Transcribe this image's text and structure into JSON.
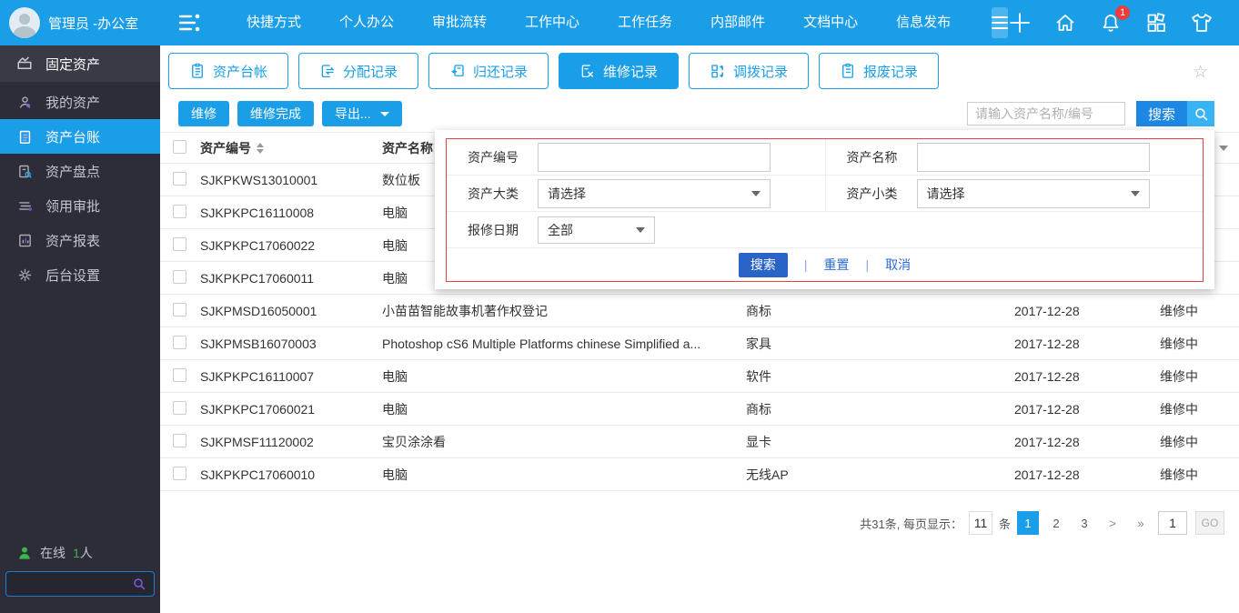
{
  "colors": {
    "accent": "#1b9ee8",
    "sidebar_bg": "#2d2d39",
    "panel_border_red": "#dd4444",
    "panel_button_blue": "#2a64c6",
    "badge_red": "#ee3b3b",
    "online_green": "#3bb54a"
  },
  "topbar": {
    "user": "管理员 -办公室",
    "menu": [
      "快捷方式",
      "个人办公",
      "审批流转",
      "工作中心",
      "工作任务",
      "内部邮件",
      "文档中心",
      "信息发布"
    ],
    "notification_badge": "1"
  },
  "sidebar": {
    "module": "固定资产",
    "items": [
      {
        "label": "我的资产",
        "active": false
      },
      {
        "label": "资产台账",
        "active": true
      },
      {
        "label": "资产盘点",
        "active": false
      },
      {
        "label": "领用审批",
        "active": false
      },
      {
        "label": "资产报表",
        "active": false
      },
      {
        "label": "后台设置",
        "active": false
      }
    ],
    "online_label": "在线",
    "online_count": "1",
    "online_unit": "人"
  },
  "tabs": [
    {
      "label": "资产台帐",
      "active": false
    },
    {
      "label": "分配记录",
      "active": false
    },
    {
      "label": "归还记录",
      "active": false
    },
    {
      "label": "维修记录",
      "active": true
    },
    {
      "label": "调拨记录",
      "active": false
    },
    {
      "label": "报废记录",
      "active": false
    }
  ],
  "toolbar": {
    "repair_label": "维修",
    "repair_done_label": "维修完成",
    "export_label": "导出...",
    "search_placeholder": "请输入资产名称/编号",
    "search_button": "搜索"
  },
  "filter": {
    "fields": [
      {
        "label": "资产编号",
        "value": ""
      },
      {
        "label": "资产名称",
        "value": ""
      },
      {
        "label": "资产大类",
        "value": "请选择"
      },
      {
        "label": "资产小类",
        "value": "请选择"
      },
      {
        "label": "报修日期",
        "value": "全部"
      }
    ],
    "buttons": {
      "search": "搜索",
      "reset": "重置",
      "cancel": "取消"
    },
    "divider": "|"
  },
  "table": {
    "headers": {
      "code": "资产编号",
      "name": "资产名称"
    },
    "rows": [
      {
        "code": "SJKPKWS13010001",
        "name": "数位板",
        "category": "",
        "date": "",
        "status": ""
      },
      {
        "code": "SJKPKPC16110008",
        "name": "电脑",
        "category": "",
        "date": "",
        "status": ""
      },
      {
        "code": "SJKPKPC17060022",
        "name": "电脑",
        "category": "",
        "date": "",
        "status": ""
      },
      {
        "code": "SJKPKPC17060011",
        "name": "电脑",
        "category": "",
        "date": "",
        "status": ""
      },
      {
        "code": "SJKPMSD16050001",
        "name": "小苗苗智能故事机著作权登记",
        "category": "商标",
        "date": "2017-12-28",
        "status": "维修中"
      },
      {
        "code": "SJKPMSB16070003",
        "name": "Photoshop cS6 Multiple Platforms chinese Simplified a...",
        "category": "家具",
        "date": "2017-12-28",
        "status": "维修中"
      },
      {
        "code": "SJKPKPC16110007",
        "name": "电脑",
        "category": "软件",
        "date": "2017-12-28",
        "status": "维修中"
      },
      {
        "code": "SJKPKPC17060021",
        "name": "电脑",
        "category": "商标",
        "date": "2017-12-28",
        "status": "维修中"
      },
      {
        "code": "SJKPMSF11120002",
        "name": "宝贝涂涂看",
        "category": "显卡",
        "date": "2017-12-28",
        "status": "维修中"
      },
      {
        "code": "SJKPKPC17060010",
        "name": "电脑",
        "category": "无线AP",
        "date": "2017-12-28",
        "status": "维修中"
      }
    ]
  },
  "pagination": {
    "total_label": "共31条, 每页显示：",
    "page_size": "11",
    "unit": "条",
    "pages": [
      "1",
      "2",
      "3"
    ],
    "next": ">",
    "last": "»",
    "goto_value": "1",
    "go_label": "GO"
  }
}
